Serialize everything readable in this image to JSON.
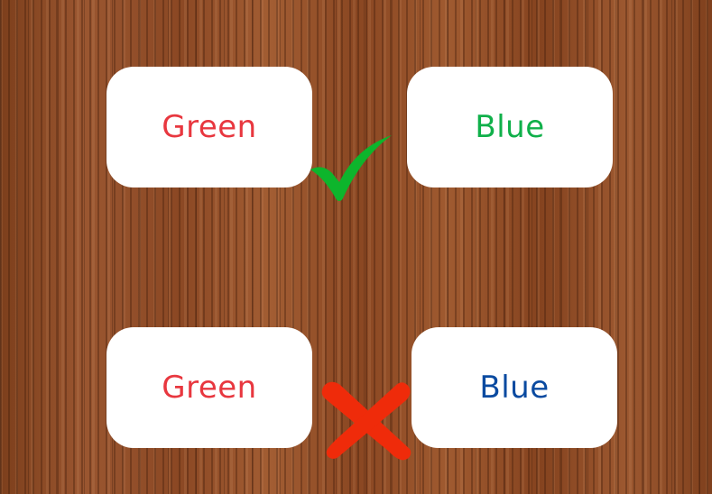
{
  "examples": [
    {
      "word_left": {
        "text": "Green",
        "color": "#e8373f"
      },
      "word_right": {
        "text": "Blue",
        "color": "#10b04a"
      },
      "verdict": "check-icon",
      "verdict_color": "#0db52c"
    },
    {
      "word_left": {
        "text": "Green",
        "color": "#e8373f"
      },
      "word_right": {
        "text": "Blue",
        "color": "#0a4aa0"
      },
      "verdict": "cross-icon",
      "verdict_color": "#ef2b0a"
    }
  ],
  "background": "wood-texture"
}
